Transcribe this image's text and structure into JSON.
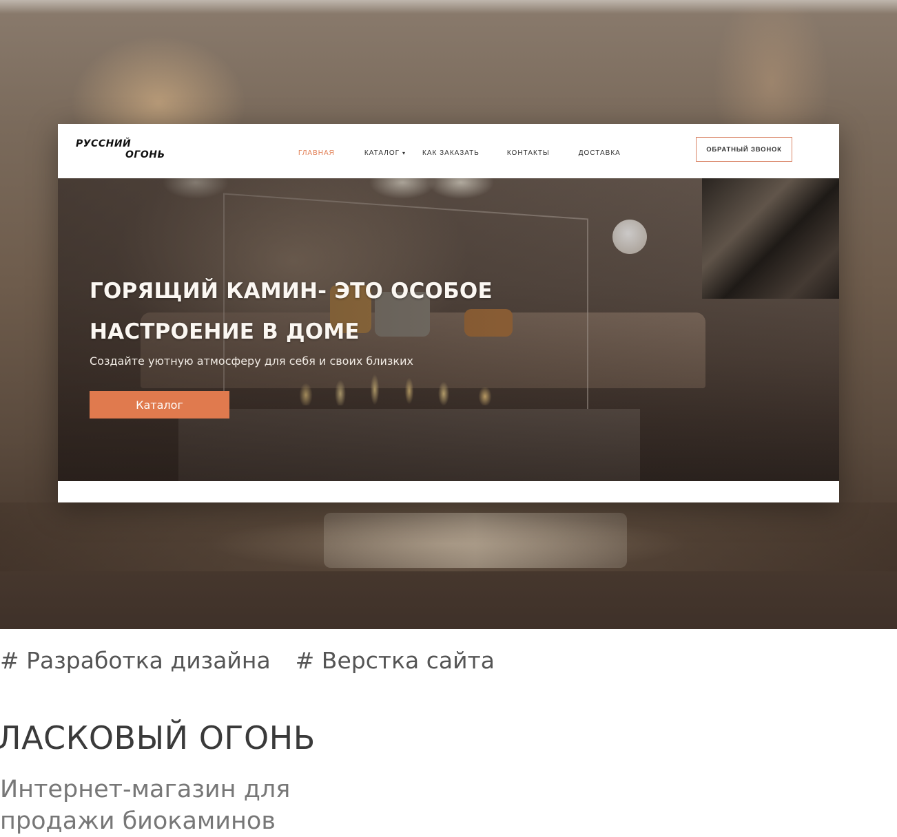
{
  "site": {
    "logo": {
      "line1": "РУССНИЙ",
      "line2": "ОГОНЬ"
    },
    "nav": [
      {
        "label": "ГЛАВНАЯ",
        "active": true
      },
      {
        "label": "КАТАЛОГ",
        "active": false,
        "has_dropdown": true
      },
      {
        "label": "КАК ЗАКАЗАТЬ",
        "active": false
      },
      {
        "label": "КОНТАКТЫ",
        "active": false
      },
      {
        "label": "ДОСТАВКА",
        "active": false
      }
    ],
    "dropdown_glyph": "▾",
    "callback_button": "ОБРАТНЫЙ ЗВОНОК",
    "hero": {
      "title_line1": "ГОРЯЩИЙ КАМИН- ЭТО ОСОБОЕ",
      "title_line2": "НАСТРОЕНИЕ В ДОМЕ",
      "subtitle": "Создайте уютную атмосферу для себя и своих близких",
      "button": "Каталог"
    }
  },
  "project": {
    "tags": [
      "# Разработка дизайна",
      "# Верстка сайта"
    ],
    "title": "ЛАСКОВЫЙ ОГОНЬ",
    "description_line1": "Интернет-магазин для",
    "description_line2": "продажи биокаминов"
  },
  "colors": {
    "accent": "#e07a4e",
    "nav_text": "#333333",
    "title_text": "#3a3a3a",
    "description_text": "#777777"
  }
}
